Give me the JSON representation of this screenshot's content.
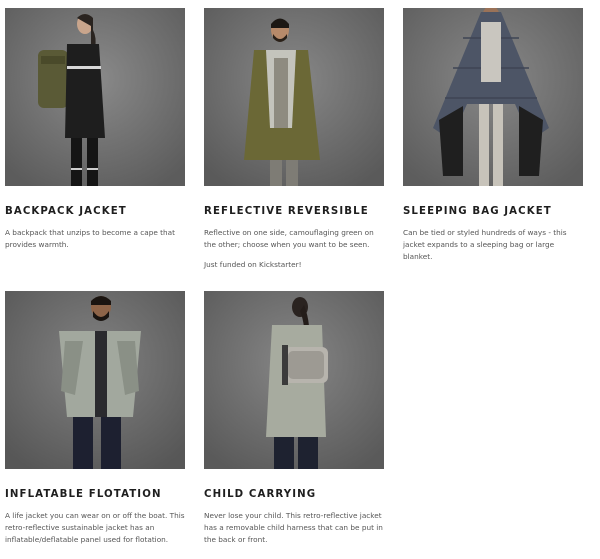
{
  "products": [
    {
      "title": "BACKPACK JACKET",
      "description": "A backpack that unzips to become a cape that provides warmth.",
      "photo_icon": "model-with-backpack-jacket"
    },
    {
      "title": "REFLECTIVE REVERSIBLE",
      "description": "Reflective on one side, camouflaging green on the other; choose when you want to be seen.",
      "note": "Just funded on Kickstarter!",
      "photo_icon": "model-in-reversible-jacket"
    },
    {
      "title": "SLEEPING BAG JACKET",
      "description": "Can be tied or styled hundreds of ways - this jacket expands to a sleeping bag or large blanket.",
      "photo_icon": "model-in-sleeping-bag-jacket"
    },
    {
      "title": "INFLATABLE FLOTATION",
      "description": "A life jacket you can wear on or off the boat. This retro-reflective sustainable jacket has an inflatable/deflatable panel used for flotation.",
      "photo_icon": "model-in-inflatable-jacket"
    },
    {
      "title": "CHILD CARRYING",
      "description": "Never lose your child. This retro-reflective jacket has a removable child harness that can be put in the back or front.",
      "photo_icon": "model-with-child-harness"
    }
  ],
  "colors": {
    "photo_background": "#6e6e6e",
    "title_text": "#1e1e1e",
    "body_text": "#555555"
  }
}
